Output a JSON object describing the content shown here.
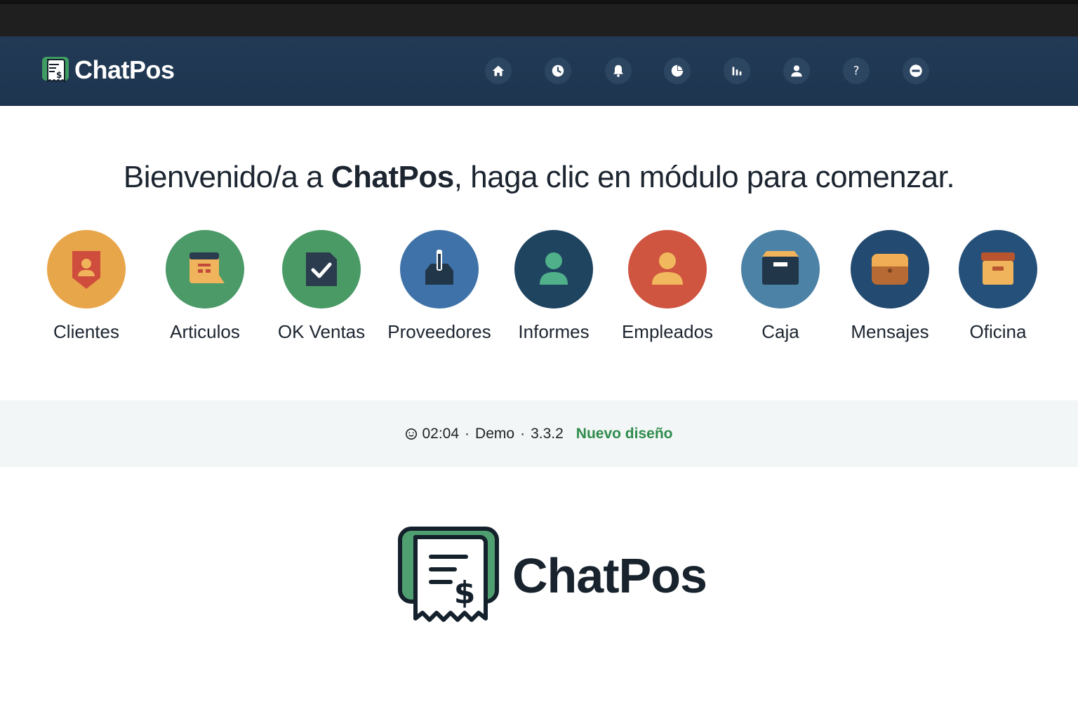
{
  "app": {
    "name": "ChatPos",
    "brand_color": "#2f8f57"
  },
  "nav": {
    "icons": [
      {
        "name": "home-icon"
      },
      {
        "name": "clock-icon"
      },
      {
        "name": "bell-icon"
      },
      {
        "name": "pie-chart-icon"
      },
      {
        "name": "bar-chart-icon"
      },
      {
        "name": "user-icon"
      },
      {
        "name": "help-icon",
        "glyph": "?"
      },
      {
        "name": "logout-icon"
      }
    ]
  },
  "welcome": {
    "prefix": "Bienvenido/a a ",
    "app_name": "ChatPos",
    "suffix": ", haga clic en módulo para comenzar."
  },
  "modules": [
    {
      "label": "Clientes",
      "color": "#e8a64a"
    },
    {
      "label": "Articulos",
      "color": "#4b9a68"
    },
    {
      "label": "OK Ventas",
      "color": "#4a9a66"
    },
    {
      "label": "Proveedores",
      "color": "#3e72a8"
    },
    {
      "label": "Informes",
      "color": "#1f4460"
    },
    {
      "label": "Empleados",
      "color": "#cf5540"
    },
    {
      "label": "Caja",
      "color": "#4b82a6"
    },
    {
      "label": "Mensajes",
      "color": "#234a70"
    },
    {
      "label": "Oficina",
      "color": "#24507a"
    }
  ],
  "status": {
    "time": "02:04",
    "separator": "·",
    "mode": "Demo",
    "version": "3.3.2",
    "new_design": "Nuevo diseño"
  },
  "footer_logo": {
    "text": "ChatPos"
  }
}
